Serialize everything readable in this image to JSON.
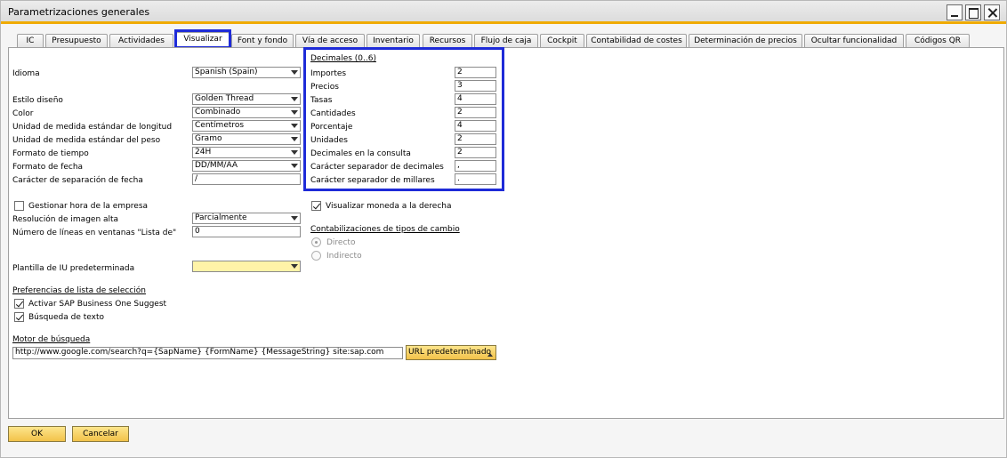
{
  "window": {
    "title": "Parametrizaciones generales"
  },
  "tabs": [
    "IC",
    "Presupuesto",
    "Actividades",
    "Visualizar",
    "Font y fondo",
    "Vía de acceso",
    "Inventario",
    "Recursos",
    "Flujo de caja",
    "Cockpit",
    "Contabilidad de costes",
    "Determinación de precios",
    "Ocultar funcionalidad",
    "Códigos QR"
  ],
  "active_tab": "Visualizar",
  "left": {
    "idioma": {
      "label": "Idioma",
      "value": "Spanish (Spain)"
    },
    "estilo": {
      "label": "Estilo diseño",
      "value": "Golden Thread"
    },
    "color": {
      "label": "Color",
      "value": "Combinado"
    },
    "longitud": {
      "label": "Unidad de medida estándar de longitud",
      "value": "Centímetros"
    },
    "peso": {
      "label": "Unidad de medida estándar del peso",
      "value": "Gramo"
    },
    "tiempo": {
      "label": "Formato de tiempo",
      "value": "24H"
    },
    "fecha": {
      "label": "Formato de fecha",
      "value": "DD/MM/AA"
    },
    "sep_fecha": {
      "label": "Carácter de separación de fecha",
      "value": "/"
    },
    "gestionar_hora": {
      "label": "Gestionar hora de la empresa",
      "checked": false
    },
    "resolucion": {
      "label": "Resolución de imagen alta",
      "value": "Parcialmente"
    },
    "lineas": {
      "label": "Número de líneas en ventanas \"Lista de\"",
      "value": "0"
    },
    "plantilla": {
      "label": "Plantilla de IU predeterminada",
      "value": ""
    },
    "pref_heading": "Preferencias de lista de selección",
    "suggest": {
      "label": "Activar SAP Business One Suggest",
      "checked": true
    },
    "busqueda": {
      "label": "Búsqueda de texto",
      "checked": true
    },
    "motor_heading": "Motor de búsqueda",
    "motor_url": "http://www.google.com/search?q={SapName} {FormName} {MessageString} site:sap.com",
    "url_button": "URL predeterminado"
  },
  "decimales": {
    "heading": "Decimales (0..6)",
    "rows": [
      {
        "label": "Importes",
        "value": "2"
      },
      {
        "label": "Precios",
        "value": "3"
      },
      {
        "label": "Tasas",
        "value": "4"
      },
      {
        "label": "Cantidades",
        "value": "2"
      },
      {
        "label": "Porcentaje",
        "value": "4"
      },
      {
        "label": "Unidades",
        "value": "2"
      },
      {
        "label": "Decimales en la consulta",
        "value": "2"
      },
      {
        "label": "Carácter separador de decimales",
        "value": ","
      },
      {
        "label": "Carácter separador de millares",
        "value": "."
      }
    ]
  },
  "right": {
    "moneda": {
      "label": "Visualizar moneda a la derecha",
      "checked": true
    },
    "tipos_heading": "Contabilizaciones de tipos de cambio",
    "directo": "Directo",
    "indirecto": "Indirecto"
  },
  "footer": {
    "ok": "OK",
    "cancel": "Cancelar"
  },
  "colors": {
    "accent": "#f0ab00",
    "highlight": "#1e2bd8",
    "button": "#f7d36b"
  }
}
